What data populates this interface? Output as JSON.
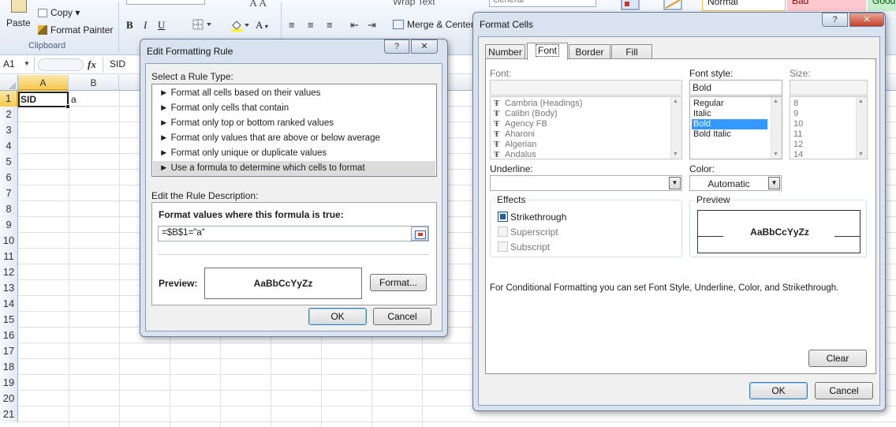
{
  "ribbon": {
    "paste_label": "Paste",
    "copy_label": "Copy ▾",
    "format_painter_label": "Format Painter",
    "clipboard_group_label": "Clipboard",
    "bold_label": "B",
    "italic_label": "I",
    "underline_label": "U",
    "grow_font_label": "A A",
    "font_color_label": "A",
    "wrap_text_label": "Wrap Text",
    "merge_center_label": "Merge & Center",
    "number_format_value": "General",
    "style_normal": "Normal",
    "style_bad": "Bad",
    "style_good": "Good"
  },
  "formula_bar": {
    "name_box": "A1",
    "fx": "fx",
    "content": "SID"
  },
  "sheet": {
    "columns": [
      "A",
      "B"
    ],
    "rows": [
      "1",
      "2",
      "3",
      "4",
      "5",
      "6",
      "7",
      "8",
      "9",
      "10",
      "11",
      "12",
      "13",
      "14",
      "15",
      "16",
      "17",
      "18",
      "19",
      "20",
      "21"
    ],
    "cells": {
      "A1": "SID",
      "B1": "a"
    }
  },
  "edit_rule_dialog": {
    "title": "Edit Formatting Rule",
    "help_button": "?",
    "close_button": "✕",
    "select_rule_type_label": "Select a Rule Type:",
    "rule_types": [
      "► Format all cells based on their values",
      "► Format only cells that contain",
      "► Format only top or bottom ranked values",
      "► Format only values that are above or below average",
      "► Format only unique or duplicate values",
      "► Use a formula to determine which cells to format"
    ],
    "selected_rule_index": 5,
    "edit_description_label": "Edit the Rule Description:",
    "formula_heading": "Format values where this formula is true:",
    "formula_value": "=$B$1=\"a\"",
    "preview_label": "Preview:",
    "preview_sample": "AaBbCcYyZz",
    "format_button": "Format...",
    "ok_button": "OK",
    "cancel_button": "Cancel"
  },
  "format_cells_dialog": {
    "title": "Format Cells",
    "help_button": "?",
    "close_button": "✕",
    "tabs": [
      "Number",
      "Font",
      "Border",
      "Fill"
    ],
    "active_tab": "Font",
    "font_label": "Font:",
    "font_value": "",
    "font_list": [
      "Cambria (Headings)",
      "Calibri (Body)",
      "Agency FB",
      "Aharoni",
      "Algerian",
      "Andalus"
    ],
    "font_style_label": "Font style:",
    "font_style_value": "Bold",
    "font_styles": [
      "Regular",
      "Italic",
      "Bold",
      "Bold Italic"
    ],
    "selected_font_style": "Bold",
    "size_label": "Size:",
    "size_value": "",
    "sizes": [
      "8",
      "9",
      "10",
      "11",
      "12",
      "14"
    ],
    "underline_label": "Underline:",
    "underline_value": "",
    "color_label": "Color:",
    "color_value": "Automatic",
    "effects_label": "Effects",
    "strikethrough_label": "Strikethrough",
    "superscript_label": "Superscript",
    "subscript_label": "Subscript",
    "preview_label": "Preview",
    "preview_sample": "AaBbCcYyZz",
    "note": "For Conditional Formatting you can set Font Style, Underline, Color, and Strikethrough.",
    "clear_button": "Clear",
    "ok_button": "OK",
    "cancel_button": "Cancel"
  },
  "colors": {
    "selection_blue": "#3399ff",
    "header_selected": "#f7c950",
    "dialog_frame": "#d9e3ef",
    "style_bad_fill": "#ffc7ce",
    "style_good_fill": "#c6efce"
  }
}
